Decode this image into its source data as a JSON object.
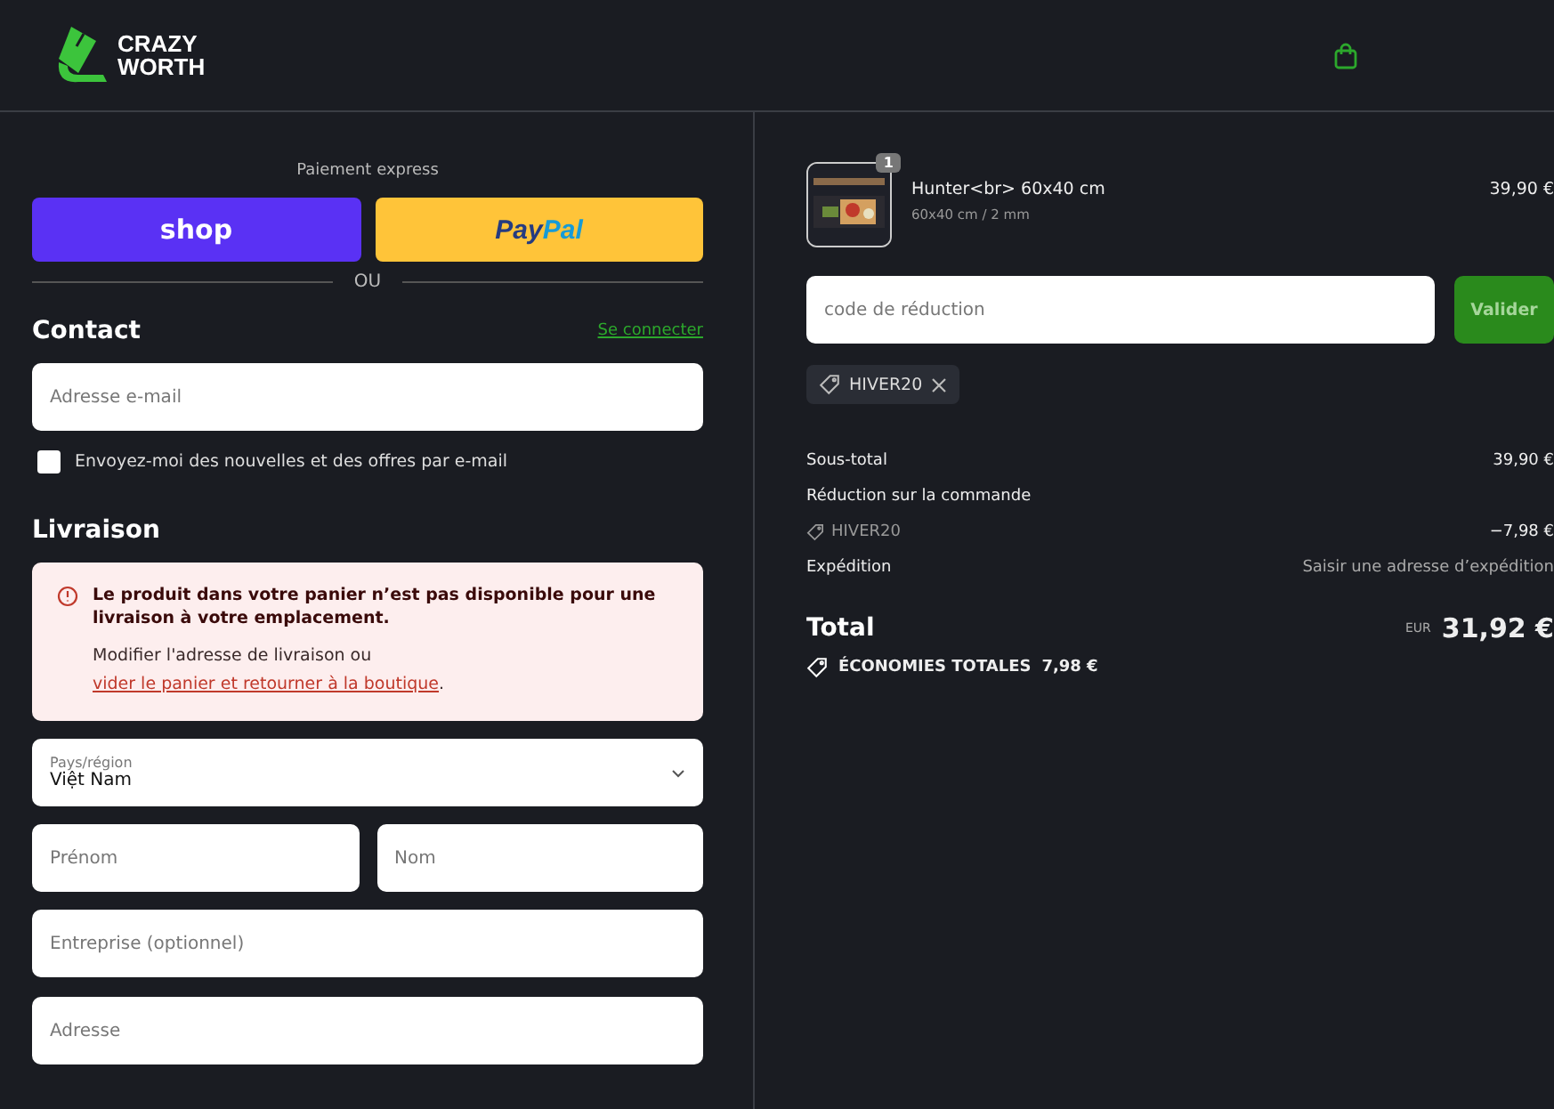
{
  "header": {
    "logo_line1": "CRAZY",
    "logo_line2": "WORTH"
  },
  "express": {
    "title": "Paiement express",
    "shop": "shop",
    "paypal_1": "Pay",
    "paypal_2": "Pal",
    "separator": "OU"
  },
  "contact": {
    "title": "Contact",
    "login_link": "Se connecter",
    "email": {
      "placeholder": "Adresse e-mail"
    },
    "newsletter": {
      "label": "Envoyez-moi des nouvelles et des offres par e-mail",
      "checked": false
    }
  },
  "delivery": {
    "title": "Livraison",
    "alert": {
      "message": "Le produit dans votre panier n’est pas disponible pour une livraison à votre emplacement.",
      "hint": "Modifier l'adresse de livraison ou",
      "link": "vider le panier et retourner à la boutique",
      "end": "."
    },
    "country": {
      "label": "Pays/région",
      "value": "Việt Nam"
    },
    "first_name": {
      "placeholder": "Prénom"
    },
    "last_name": {
      "placeholder": "Nom"
    },
    "company": {
      "placeholder": "Entreprise (optionnel)"
    },
    "address": {
      "placeholder": "Adresse"
    }
  },
  "cart": {
    "item": {
      "quantity": "1",
      "name": "Hunter<br> 60x40 cm",
      "variant": "60x40 cm / 2 mm",
      "price": "39,90 €"
    },
    "discount": {
      "placeholder": "code de réduction",
      "button": "Valider",
      "applied": "HIVER20"
    },
    "summary": [
      {
        "label": "Sous-total",
        "value": "39,90 €",
        "kind": "plain"
      },
      {
        "label": "Réduction sur la commande",
        "kind": "heading"
      },
      {
        "label": "HIVER20",
        "value": "−7,98 €",
        "kind": "code"
      },
      {
        "label": "Expédition",
        "value": "Saisir une adresse d’expédition",
        "kind": "muted"
      }
    ],
    "total": {
      "label": "Total",
      "currency": "EUR",
      "value": "31,92 €"
    },
    "savings": {
      "label": "ÉCONOMIES TOTALES",
      "value": "7,98 €"
    }
  }
}
